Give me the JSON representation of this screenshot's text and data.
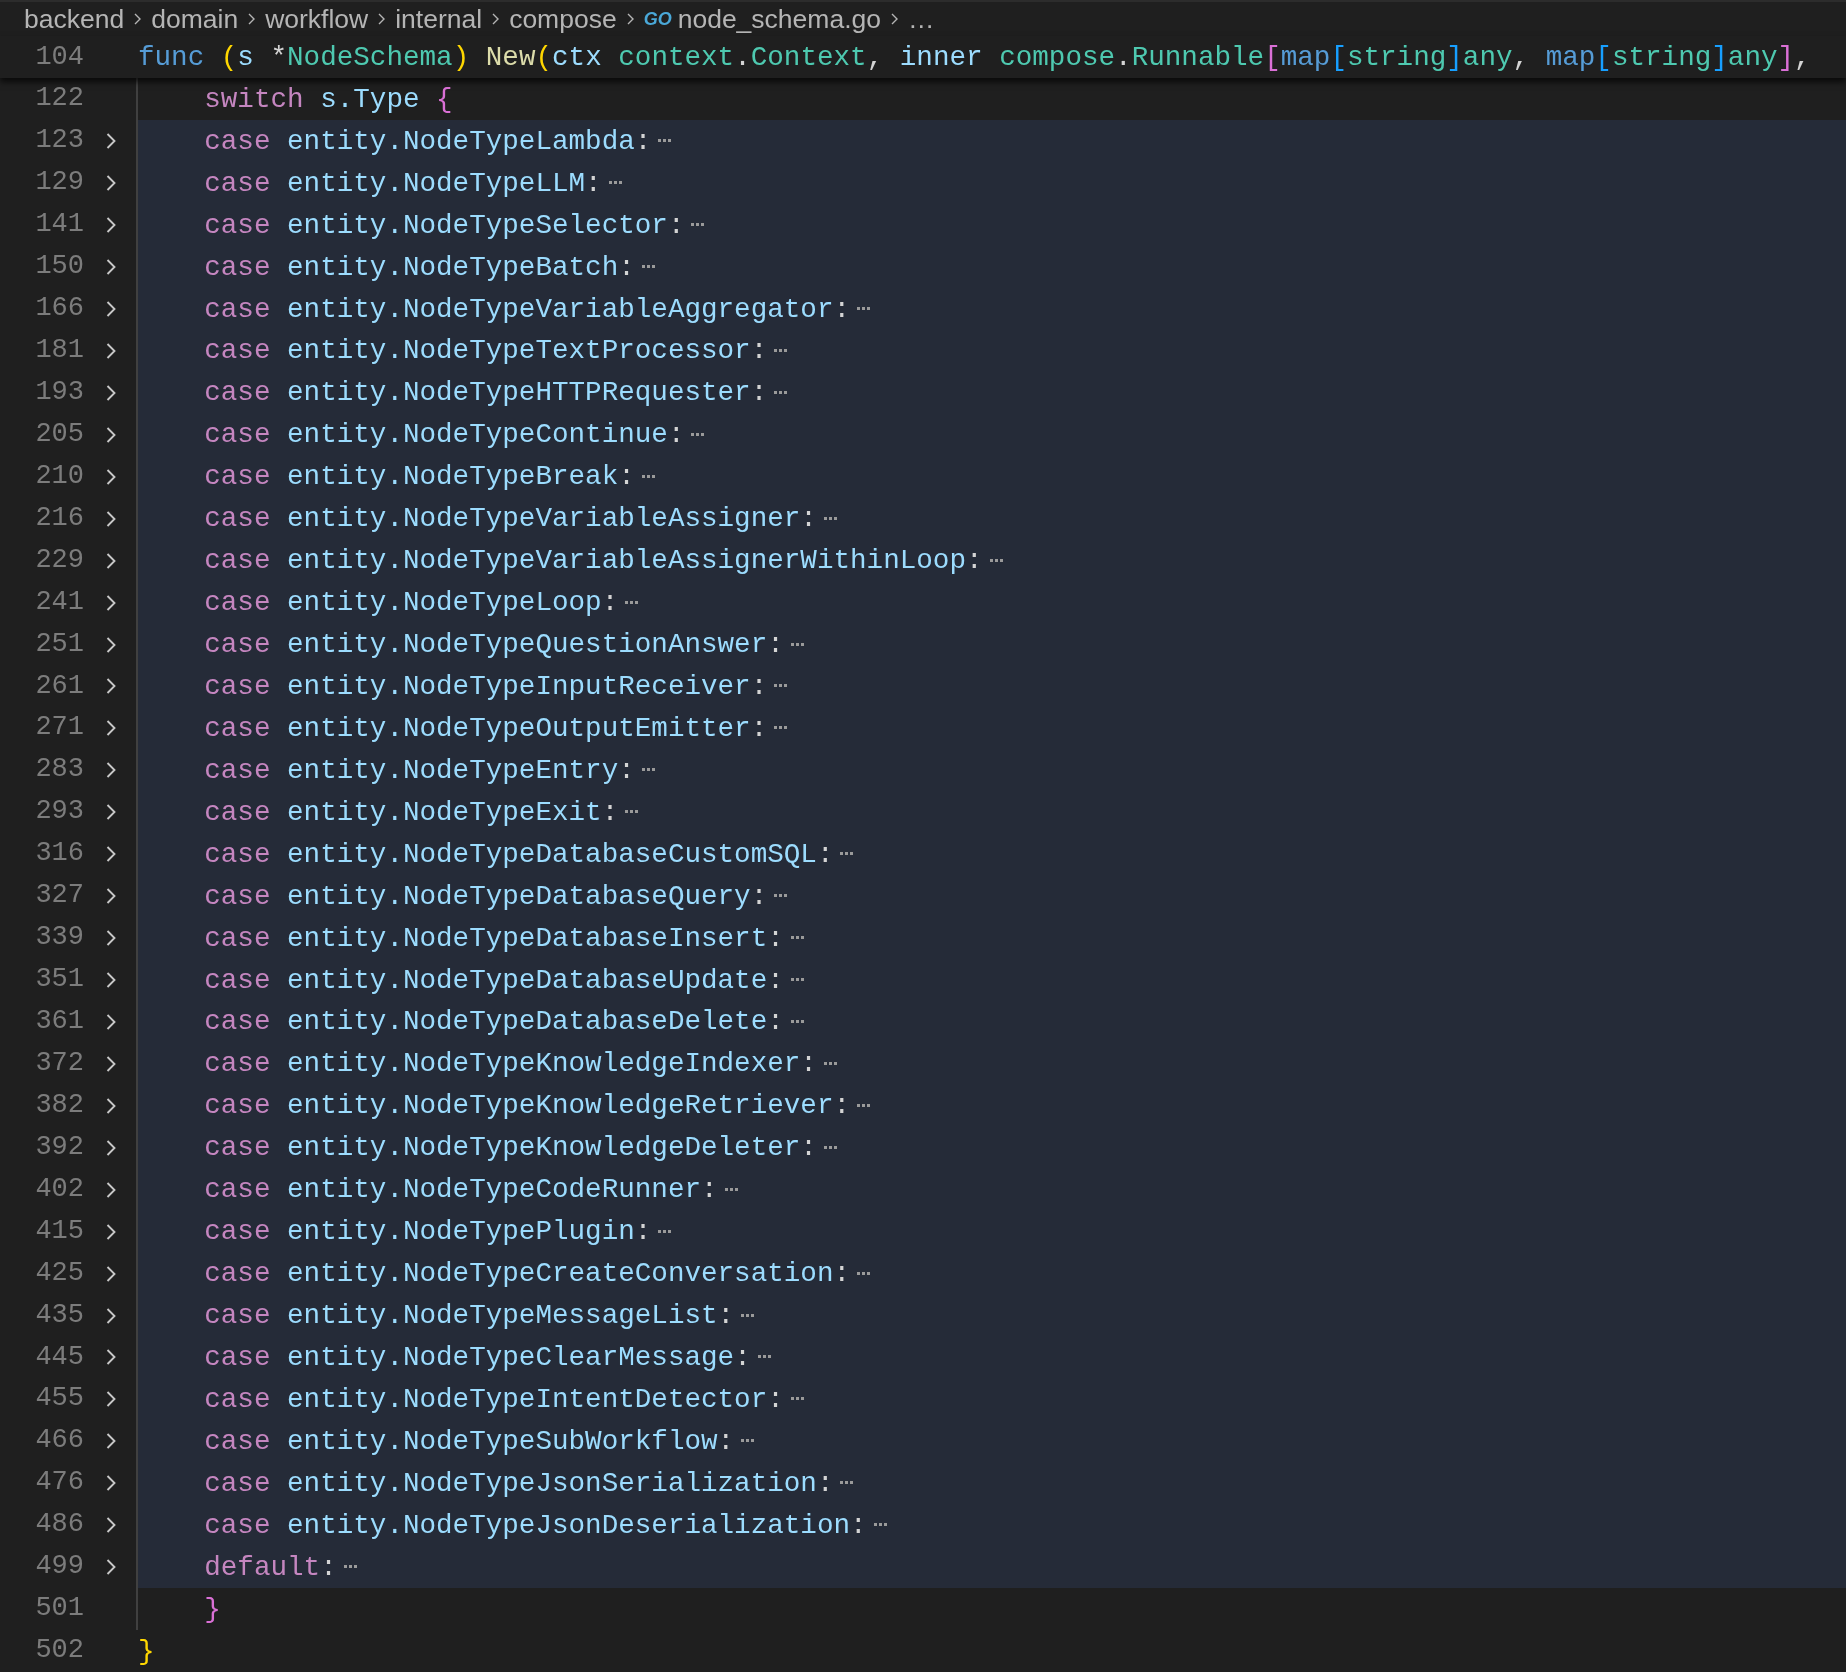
{
  "breadcrumb": {
    "items": [
      {
        "label": "backend",
        "kind": "folder"
      },
      {
        "label": "domain",
        "kind": "folder"
      },
      {
        "label": "workflow",
        "kind": "folder"
      },
      {
        "label": "internal",
        "kind": "folder"
      },
      {
        "label": "compose",
        "kind": "folder"
      },
      {
        "label": "node_schema.go",
        "kind": "gofile",
        "icon": "GO"
      },
      {
        "label": "…",
        "kind": "more"
      }
    ]
  },
  "sticky_scroll": {
    "number": "104",
    "tokens": [
      {
        "kind": "keyword",
        "text": "func "
      },
      {
        "kind": "bracket1",
        "text": "("
      },
      {
        "kind": "variable",
        "text": "s "
      },
      {
        "kind": "plain",
        "text": "*"
      },
      {
        "kind": "type",
        "text": "NodeSchema"
      },
      {
        "kind": "bracket1",
        "text": ")"
      },
      {
        "kind": "function",
        "text": " New"
      },
      {
        "kind": "bracket1",
        "text": "("
      },
      {
        "kind": "variable",
        "text": "ctx "
      },
      {
        "kind": "type",
        "text": "context"
      },
      {
        "kind": "plain",
        "text": "."
      },
      {
        "kind": "type",
        "text": "Context"
      },
      {
        "kind": "plain",
        "text": ", "
      },
      {
        "kind": "variable",
        "text": "inner "
      },
      {
        "kind": "type",
        "text": "compose"
      },
      {
        "kind": "plain",
        "text": "."
      },
      {
        "kind": "type",
        "text": "Runnable"
      },
      {
        "kind": "bracket2",
        "text": "["
      },
      {
        "kind": "keyword",
        "text": "map"
      },
      {
        "kind": "bracket3",
        "text": "["
      },
      {
        "kind": "type",
        "text": "string"
      },
      {
        "kind": "bracket3",
        "text": "]"
      },
      {
        "kind": "type",
        "text": "any"
      },
      {
        "kind": "plain",
        "text": ", "
      },
      {
        "kind": "keyword",
        "text": "map"
      },
      {
        "kind": "bracket3",
        "text": "["
      },
      {
        "kind": "type",
        "text": "string"
      },
      {
        "kind": "bracket3",
        "text": "]"
      },
      {
        "kind": "type",
        "text": "any"
      },
      {
        "kind": "bracket2",
        "text": "]"
      },
      {
        "kind": "plain",
        "text": ","
      }
    ]
  },
  "lines": [
    {
      "number": "122",
      "folded": false,
      "highlighted": false,
      "guide": true,
      "tokens": [
        {
          "kind": "control",
          "text": "    switch "
        },
        {
          "kind": "variable",
          "text": "s.Type "
        },
        {
          "kind": "bracket2",
          "text": "{"
        }
      ]
    },
    {
      "number": "123",
      "folded": true,
      "highlighted": true,
      "guide": true,
      "tokens": [
        {
          "kind": "control",
          "text": "    case "
        },
        {
          "kind": "variable",
          "text": "entity.NodeTypeLambda"
        },
        {
          "kind": "plain",
          "text": ":"
        }
      ]
    },
    {
      "number": "129",
      "folded": true,
      "highlighted": true,
      "guide": true,
      "tokens": [
        {
          "kind": "control",
          "text": "    case "
        },
        {
          "kind": "variable",
          "text": "entity.NodeTypeLLM"
        },
        {
          "kind": "plain",
          "text": ":"
        }
      ]
    },
    {
      "number": "141",
      "folded": true,
      "highlighted": true,
      "guide": true,
      "tokens": [
        {
          "kind": "control",
          "text": "    case "
        },
        {
          "kind": "variable",
          "text": "entity.NodeTypeSelector"
        },
        {
          "kind": "plain",
          "text": ":"
        }
      ]
    },
    {
      "number": "150",
      "folded": true,
      "highlighted": true,
      "guide": true,
      "tokens": [
        {
          "kind": "control",
          "text": "    case "
        },
        {
          "kind": "variable",
          "text": "entity.NodeTypeBatch"
        },
        {
          "kind": "plain",
          "text": ":"
        }
      ]
    },
    {
      "number": "166",
      "folded": true,
      "highlighted": true,
      "guide": true,
      "tokens": [
        {
          "kind": "control",
          "text": "    case "
        },
        {
          "kind": "variable",
          "text": "entity.NodeTypeVariableAggregator"
        },
        {
          "kind": "plain",
          "text": ":"
        }
      ]
    },
    {
      "number": "181",
      "folded": true,
      "highlighted": true,
      "guide": true,
      "tokens": [
        {
          "kind": "control",
          "text": "    case "
        },
        {
          "kind": "variable",
          "text": "entity.NodeTypeTextProcessor"
        },
        {
          "kind": "plain",
          "text": ":"
        }
      ]
    },
    {
      "number": "193",
      "folded": true,
      "highlighted": true,
      "guide": true,
      "tokens": [
        {
          "kind": "control",
          "text": "    case "
        },
        {
          "kind": "variable",
          "text": "entity.NodeTypeHTTPRequester"
        },
        {
          "kind": "plain",
          "text": ":"
        }
      ]
    },
    {
      "number": "205",
      "folded": true,
      "highlighted": true,
      "guide": true,
      "tokens": [
        {
          "kind": "control",
          "text": "    case "
        },
        {
          "kind": "variable",
          "text": "entity.NodeTypeContinue"
        },
        {
          "kind": "plain",
          "text": ":"
        }
      ]
    },
    {
      "number": "210",
      "folded": true,
      "highlighted": true,
      "guide": true,
      "tokens": [
        {
          "kind": "control",
          "text": "    case "
        },
        {
          "kind": "variable",
          "text": "entity.NodeTypeBreak"
        },
        {
          "kind": "plain",
          "text": ":"
        }
      ]
    },
    {
      "number": "216",
      "folded": true,
      "highlighted": true,
      "guide": true,
      "tokens": [
        {
          "kind": "control",
          "text": "    case "
        },
        {
          "kind": "variable",
          "text": "entity.NodeTypeVariableAssigner"
        },
        {
          "kind": "plain",
          "text": ":"
        }
      ]
    },
    {
      "number": "229",
      "folded": true,
      "highlighted": true,
      "guide": true,
      "tokens": [
        {
          "kind": "control",
          "text": "    case "
        },
        {
          "kind": "variable",
          "text": "entity.NodeTypeVariableAssignerWithinLoop"
        },
        {
          "kind": "plain",
          "text": ":"
        }
      ]
    },
    {
      "number": "241",
      "folded": true,
      "highlighted": true,
      "guide": true,
      "tokens": [
        {
          "kind": "control",
          "text": "    case "
        },
        {
          "kind": "variable",
          "text": "entity.NodeTypeLoop"
        },
        {
          "kind": "plain",
          "text": ":"
        }
      ]
    },
    {
      "number": "251",
      "folded": true,
      "highlighted": true,
      "guide": true,
      "tokens": [
        {
          "kind": "control",
          "text": "    case "
        },
        {
          "kind": "variable",
          "text": "entity.NodeTypeQuestionAnswer"
        },
        {
          "kind": "plain",
          "text": ":"
        }
      ]
    },
    {
      "number": "261",
      "folded": true,
      "highlighted": true,
      "guide": true,
      "tokens": [
        {
          "kind": "control",
          "text": "    case "
        },
        {
          "kind": "variable",
          "text": "entity.NodeTypeInputReceiver"
        },
        {
          "kind": "plain",
          "text": ":"
        }
      ]
    },
    {
      "number": "271",
      "folded": true,
      "highlighted": true,
      "guide": true,
      "tokens": [
        {
          "kind": "control",
          "text": "    case "
        },
        {
          "kind": "variable",
          "text": "entity.NodeTypeOutputEmitter"
        },
        {
          "kind": "plain",
          "text": ":"
        }
      ]
    },
    {
      "number": "283",
      "folded": true,
      "highlighted": true,
      "guide": true,
      "tokens": [
        {
          "kind": "control",
          "text": "    case "
        },
        {
          "kind": "variable",
          "text": "entity.NodeTypeEntry"
        },
        {
          "kind": "plain",
          "text": ":"
        }
      ]
    },
    {
      "number": "293",
      "folded": true,
      "highlighted": true,
      "guide": true,
      "tokens": [
        {
          "kind": "control",
          "text": "    case "
        },
        {
          "kind": "variable",
          "text": "entity.NodeTypeExit"
        },
        {
          "kind": "plain",
          "text": ":"
        }
      ]
    },
    {
      "number": "316",
      "folded": true,
      "highlighted": true,
      "guide": true,
      "tokens": [
        {
          "kind": "control",
          "text": "    case "
        },
        {
          "kind": "variable",
          "text": "entity.NodeTypeDatabaseCustomSQL"
        },
        {
          "kind": "plain",
          "text": ":"
        }
      ]
    },
    {
      "number": "327",
      "folded": true,
      "highlighted": true,
      "guide": true,
      "tokens": [
        {
          "kind": "control",
          "text": "    case "
        },
        {
          "kind": "variable",
          "text": "entity.NodeTypeDatabaseQuery"
        },
        {
          "kind": "plain",
          "text": ":"
        }
      ]
    },
    {
      "number": "339",
      "folded": true,
      "highlighted": true,
      "guide": true,
      "tokens": [
        {
          "kind": "control",
          "text": "    case "
        },
        {
          "kind": "variable",
          "text": "entity.NodeTypeDatabaseInsert"
        },
        {
          "kind": "plain",
          "text": ":"
        }
      ]
    },
    {
      "number": "351",
      "folded": true,
      "highlighted": true,
      "guide": true,
      "tokens": [
        {
          "kind": "control",
          "text": "    case "
        },
        {
          "kind": "variable",
          "text": "entity.NodeTypeDatabaseUpdate"
        },
        {
          "kind": "plain",
          "text": ":"
        }
      ]
    },
    {
      "number": "361",
      "folded": true,
      "highlighted": true,
      "guide": true,
      "tokens": [
        {
          "kind": "control",
          "text": "    case "
        },
        {
          "kind": "variable",
          "text": "entity.NodeTypeDatabaseDelete"
        },
        {
          "kind": "plain",
          "text": ":"
        }
      ]
    },
    {
      "number": "372",
      "folded": true,
      "highlighted": true,
      "guide": true,
      "tokens": [
        {
          "kind": "control",
          "text": "    case "
        },
        {
          "kind": "variable",
          "text": "entity.NodeTypeKnowledgeIndexer"
        },
        {
          "kind": "plain",
          "text": ":"
        }
      ]
    },
    {
      "number": "382",
      "folded": true,
      "highlighted": true,
      "guide": true,
      "tokens": [
        {
          "kind": "control",
          "text": "    case "
        },
        {
          "kind": "variable",
          "text": "entity.NodeTypeKnowledgeRetriever"
        },
        {
          "kind": "plain",
          "text": ":"
        }
      ]
    },
    {
      "number": "392",
      "folded": true,
      "highlighted": true,
      "guide": true,
      "tokens": [
        {
          "kind": "control",
          "text": "    case "
        },
        {
          "kind": "variable",
          "text": "entity.NodeTypeKnowledgeDeleter"
        },
        {
          "kind": "plain",
          "text": ":"
        }
      ]
    },
    {
      "number": "402",
      "folded": true,
      "highlighted": true,
      "guide": true,
      "tokens": [
        {
          "kind": "control",
          "text": "    case "
        },
        {
          "kind": "variable",
          "text": "entity.NodeTypeCodeRunner"
        },
        {
          "kind": "plain",
          "text": ":"
        }
      ]
    },
    {
      "number": "415",
      "folded": true,
      "highlighted": true,
      "guide": true,
      "tokens": [
        {
          "kind": "control",
          "text": "    case "
        },
        {
          "kind": "variable",
          "text": "entity.NodeTypePlugin"
        },
        {
          "kind": "plain",
          "text": ":"
        }
      ]
    },
    {
      "number": "425",
      "folded": true,
      "highlighted": true,
      "guide": true,
      "tokens": [
        {
          "kind": "control",
          "text": "    case "
        },
        {
          "kind": "variable",
          "text": "entity.NodeTypeCreateConversation"
        },
        {
          "kind": "plain",
          "text": ":"
        }
      ]
    },
    {
      "number": "435",
      "folded": true,
      "highlighted": true,
      "guide": true,
      "tokens": [
        {
          "kind": "control",
          "text": "    case "
        },
        {
          "kind": "variable",
          "text": "entity.NodeTypeMessageList"
        },
        {
          "kind": "plain",
          "text": ":"
        }
      ]
    },
    {
      "number": "445",
      "folded": true,
      "highlighted": true,
      "guide": true,
      "tokens": [
        {
          "kind": "control",
          "text": "    case "
        },
        {
          "kind": "variable",
          "text": "entity.NodeTypeClearMessage"
        },
        {
          "kind": "plain",
          "text": ":"
        }
      ]
    },
    {
      "number": "455",
      "folded": true,
      "highlighted": true,
      "guide": true,
      "tokens": [
        {
          "kind": "control",
          "text": "    case "
        },
        {
          "kind": "variable",
          "text": "entity.NodeTypeIntentDetector"
        },
        {
          "kind": "plain",
          "text": ":"
        }
      ]
    },
    {
      "number": "466",
      "folded": true,
      "highlighted": true,
      "guide": true,
      "tokens": [
        {
          "kind": "control",
          "text": "    case "
        },
        {
          "kind": "variable",
          "text": "entity.NodeTypeSubWorkflow"
        },
        {
          "kind": "plain",
          "text": ":"
        }
      ]
    },
    {
      "number": "476",
      "folded": true,
      "highlighted": true,
      "guide": true,
      "tokens": [
        {
          "kind": "control",
          "text": "    case "
        },
        {
          "kind": "variable",
          "text": "entity.NodeTypeJsonSerialization"
        },
        {
          "kind": "plain",
          "text": ":"
        }
      ]
    },
    {
      "number": "486",
      "folded": true,
      "highlighted": true,
      "guide": true,
      "tokens": [
        {
          "kind": "control",
          "text": "    case "
        },
        {
          "kind": "variable",
          "text": "entity.NodeTypeJsonDeserialization"
        },
        {
          "kind": "plain",
          "text": ":"
        }
      ]
    },
    {
      "number": "499",
      "folded": true,
      "highlighted": true,
      "guide": true,
      "tokens": [
        {
          "kind": "control",
          "text": "    default"
        },
        {
          "kind": "plain",
          "text": ":"
        }
      ]
    },
    {
      "number": "501",
      "folded": false,
      "highlighted": false,
      "guide": true,
      "tokens": [
        {
          "kind": "bracket2",
          "text": "    }"
        }
      ]
    },
    {
      "number": "502",
      "folded": false,
      "highlighted": false,
      "guide": false,
      "tokens": [
        {
          "kind": "bracket1",
          "text": "}"
        }
      ]
    }
  ]
}
